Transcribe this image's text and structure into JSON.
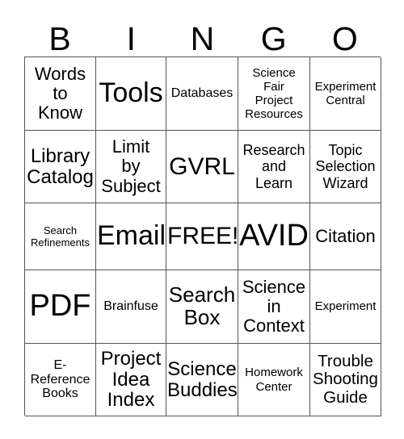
{
  "card": {
    "header_letters": [
      "B",
      "I",
      "N",
      "G",
      "O"
    ],
    "grid_line_color": "#555555",
    "background_color": "#ffffff",
    "text_color": "#000000",
    "rows": 5,
    "columns": 5,
    "cells": [
      [
        {
          "text": "Words\nto\nKnow",
          "size": "fs-22"
        },
        {
          "text": "Tools",
          "size": "fs-34"
        },
        {
          "text": "Databases",
          "size": "fs-16"
        },
        {
          "text": "Science\nFair\nProject\nResources",
          "size": "fs-15"
        },
        {
          "text": "Experiment\nCentral",
          "size": "fs-15"
        }
      ],
      [
        {
          "text": "Library\nCatalog",
          "size": "fs-24"
        },
        {
          "text": "Limit\nby\nSubject",
          "size": "fs-22"
        },
        {
          "text": "GVRL",
          "size": "fs-30"
        },
        {
          "text": "Research\nand\nLearn",
          "size": "fs-18"
        },
        {
          "text": "Topic\nSelection\nWizard",
          "size": "fs-18"
        }
      ],
      [
        {
          "text": "Search\nRefinements",
          "size": "fs-13"
        },
        {
          "text": "Email",
          "size": "fs-34"
        },
        {
          "text": "FREE!",
          "size": "fs-30"
        },
        {
          "text": "AVID",
          "size": "fs-38"
        },
        {
          "text": "Citation",
          "size": "fs-22"
        }
      ],
      [
        {
          "text": "PDF",
          "size": "fs-38"
        },
        {
          "text": "Brainfuse",
          "size": "fs-16"
        },
        {
          "text": "Search\nBox",
          "size": "fs-26"
        },
        {
          "text": "Science\nin\nContext",
          "size": "fs-22"
        },
        {
          "text": "Experiment",
          "size": "fs-15"
        }
      ],
      [
        {
          "text": "E-\nReference\nBooks",
          "size": "fs-16"
        },
        {
          "text": "Project\nIdea\nIndex",
          "size": "fs-24"
        },
        {
          "text": "Science\nBuddies",
          "size": "fs-24"
        },
        {
          "text": "Homework\nCenter",
          "size": "fs-15"
        },
        {
          "text": "Trouble\nShooting\nGuide",
          "size": "fs-20"
        }
      ]
    ]
  }
}
